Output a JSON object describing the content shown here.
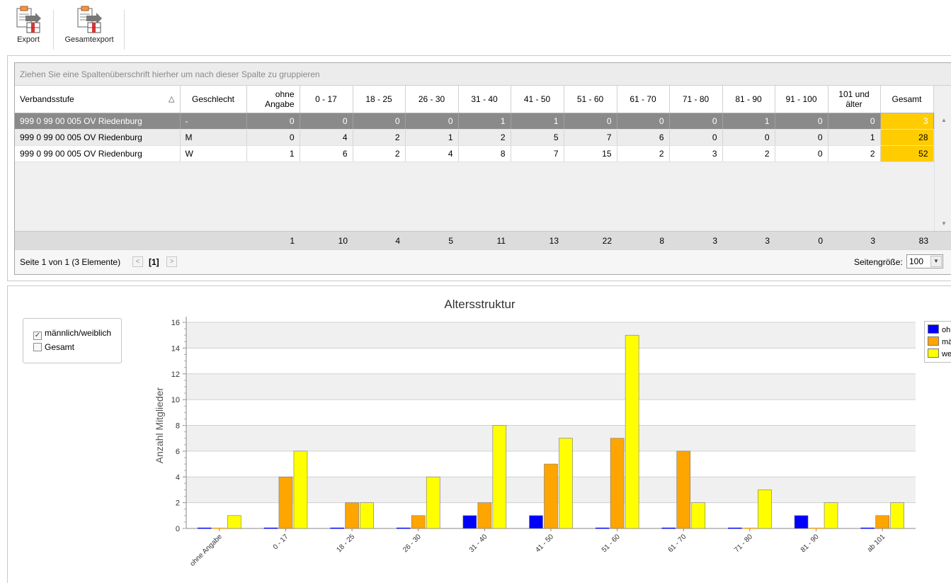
{
  "toolbar": {
    "buttons": [
      {
        "label": "Export",
        "icon": "export-icon"
      },
      {
        "label": "Gesamtexport",
        "icon": "export-all-icon"
      }
    ]
  },
  "grid": {
    "group_hint": "Ziehen Sie eine Spaltenüberschrift hierher um nach dieser Spalte zu gruppieren",
    "columns": [
      "Verbandsstufe",
      "Geschlecht",
      "ohne Angabe",
      "0 - 17",
      "18 - 25",
      "26 - 30",
      "31 - 40",
      "41 - 50",
      "51 - 60",
      "61 - 70",
      "71 - 80",
      "81 - 90",
      "91 - 100",
      "101 und älter",
      "Gesamt"
    ],
    "sort_indicator": "△",
    "rows": [
      {
        "cells": [
          "999 0 99 00 005 OV Riedenburg",
          "-",
          "0",
          "0",
          "0",
          "0",
          "1",
          "1",
          "0",
          "0",
          "0",
          "1",
          "0",
          "0",
          "3"
        ]
      },
      {
        "cells": [
          "999 0 99 00 005 OV Riedenburg",
          "M",
          "0",
          "4",
          "2",
          "1",
          "2",
          "5",
          "7",
          "6",
          "0",
          "0",
          "0",
          "1",
          "28"
        ]
      },
      {
        "cells": [
          "999 0 99 00 005 OV Riedenburg",
          "W",
          "1",
          "6",
          "2",
          "4",
          "8",
          "7",
          "15",
          "2",
          "3",
          "2",
          "0",
          "2",
          "52"
        ]
      }
    ],
    "totals": [
      "1",
      "10",
      "4",
      "5",
      "11",
      "13",
      "22",
      "8",
      "3",
      "3",
      "0",
      "3",
      "83"
    ],
    "pager": {
      "info": "Seite 1 von 1 (3 Elemente)",
      "current": "[1]",
      "page_size_label": "Seitengröße:",
      "page_size": "100"
    }
  },
  "options": {
    "items": [
      {
        "label": "männlich/weiblich",
        "checked": true
      },
      {
        "label": "Gesamt",
        "checked": false
      }
    ]
  },
  "chart_data": {
    "type": "bar",
    "title": "Altersstruktur",
    "xlabel": "",
    "ylabel": "Anzahl Mitglieder",
    "ylim": [
      0,
      16
    ],
    "yticks": [
      0,
      2,
      4,
      6,
      8,
      10,
      12,
      14,
      16
    ],
    "categories": [
      "ohne Angabe",
      "0 - 17",
      "18 - 25",
      "26 - 30",
      "31 - 40",
      "41 - 50",
      "51 - 60",
      "61 - 70",
      "71 - 80",
      "81 - 90",
      "ab 101"
    ],
    "series": [
      {
        "name": "ohne",
        "color": "#0000ff",
        "values": [
          0,
          0,
          0,
          0,
          1,
          1,
          0,
          0,
          0,
          1,
          0
        ]
      },
      {
        "name": "mä",
        "color": "#ffa500",
        "values": [
          0,
          4,
          2,
          1,
          2,
          5,
          7,
          6,
          0,
          0,
          1
        ]
      },
      {
        "name": "we",
        "color": "#ffff00",
        "values": [
          1,
          6,
          2,
          4,
          8,
          7,
          15,
          2,
          3,
          2,
          2
        ]
      }
    ],
    "grid": true,
    "legend": "right"
  }
}
